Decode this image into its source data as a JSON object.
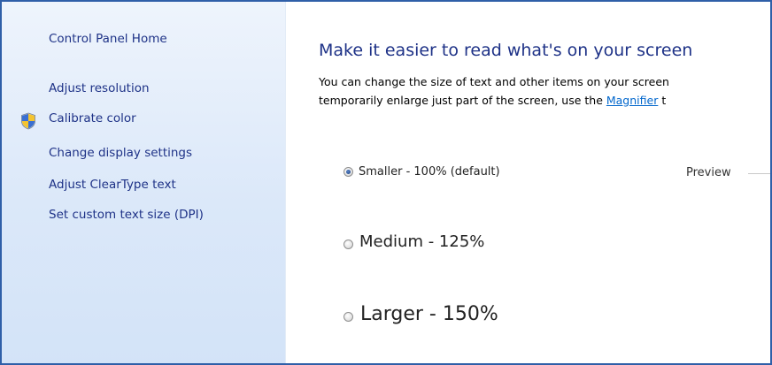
{
  "sidebar": {
    "home_link": "Control Panel Home",
    "links": [
      "Adjust resolution",
      "Calibrate color",
      "Change display settings",
      "Adjust ClearType text",
      "Set custom text size (DPI)"
    ],
    "calibrate_icon": "uac-shield-icon"
  },
  "main": {
    "title": "Make it easier to read what's on your screen",
    "description_line1": "You can change the size of text and other items on your screen",
    "description_line2_prefix": "temporarily enlarge just part of the screen, use the ",
    "magnifier_link": "Magnifier",
    "description_line2_suffix": " t",
    "options": [
      {
        "label": "Smaller - 100% (default)",
        "checked": true
      },
      {
        "label": "Medium - 125%",
        "checked": false
      },
      {
        "label": "Larger - 150%",
        "checked": false
      }
    ],
    "preview_label": "Preview"
  },
  "colors": {
    "link": "#1e3287",
    "hyperlink": "#0066cc",
    "sidebar_bg": "#dbe8f9",
    "frame_border": "#2f5fa8"
  }
}
